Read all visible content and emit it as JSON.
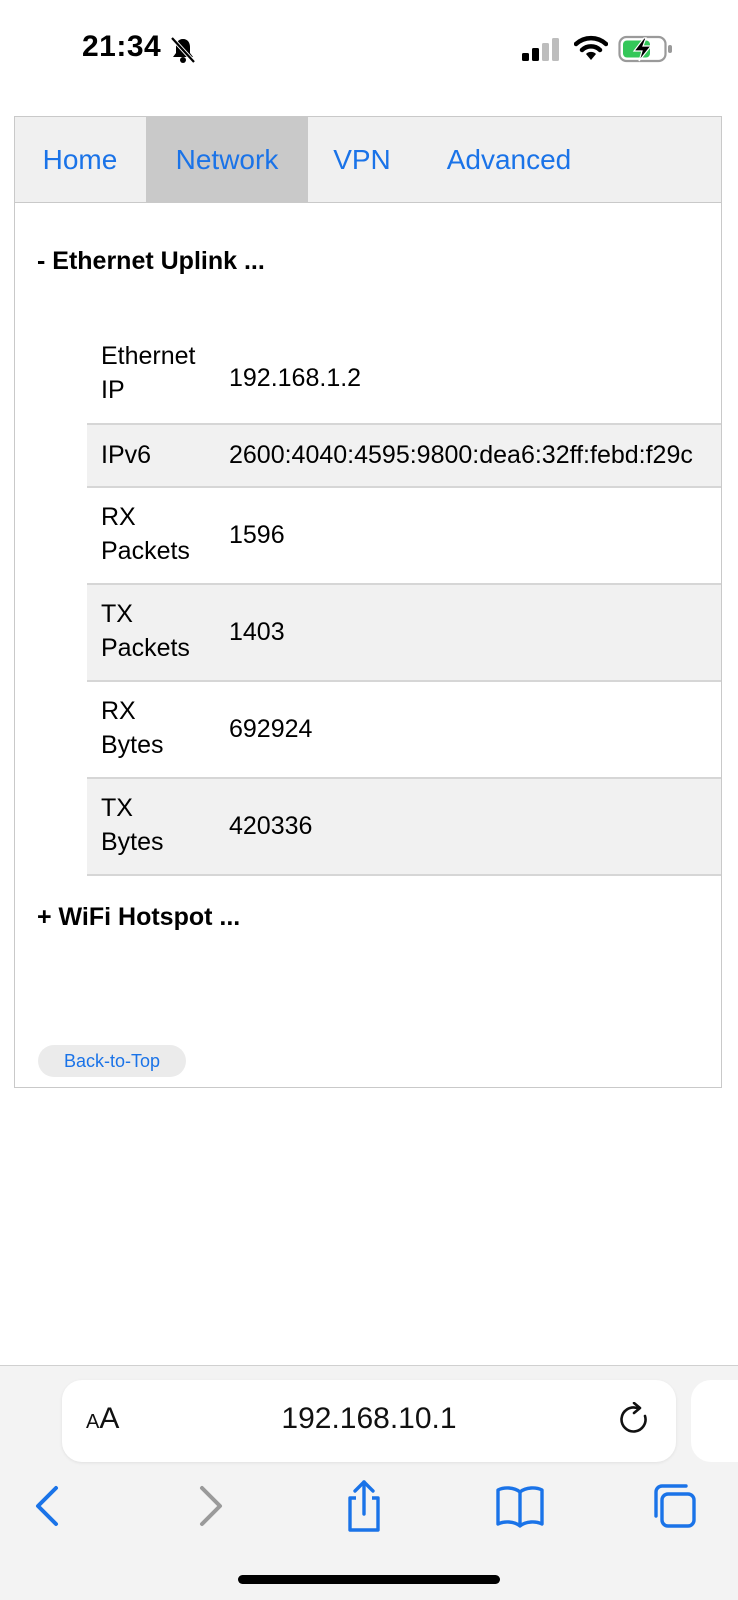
{
  "status_bar": {
    "time": "21:34",
    "colors": {
      "battery_fill": "#34c759"
    }
  },
  "tabs": [
    {
      "label": "Home",
      "active": false
    },
    {
      "label": "Network",
      "active": true
    },
    {
      "label": "VPN",
      "active": false
    },
    {
      "label": "Advanced",
      "active": false
    }
  ],
  "ethernet": {
    "heading": "- Ethernet Uplink ...",
    "rows": [
      {
        "key_line1": "Ethernet",
        "key_line2": "IP",
        "value": "192.168.1.2"
      },
      {
        "key_line1": "IPv6",
        "key_line2": "",
        "value": "2600:4040:4595:9800:dea6:32ff:febd:f29c"
      },
      {
        "key_line1": "RX",
        "key_line2": "Packets",
        "value": "1596"
      },
      {
        "key_line1": "TX",
        "key_line2": "Packets",
        "value": "1403"
      },
      {
        "key_line1": "RX",
        "key_line2": "Bytes",
        "value": "692924"
      },
      {
        "key_line1": "TX",
        "key_line2": "Bytes",
        "value": "420336"
      }
    ]
  },
  "wifi": {
    "heading": "+ WiFi Hotspot ..."
  },
  "back_to_top": "Back-to-Top",
  "browser": {
    "text_size_small": "A",
    "text_size_large": "A",
    "url": "192.168.10.1",
    "icons": [
      "back-icon",
      "forward-icon",
      "share-icon",
      "bookmarks-icon",
      "tabs-icon",
      "reload-icon"
    ]
  },
  "colors": {
    "link": "#1a73e8",
    "tab_active_bg": "#c9c9c9",
    "row_alt_bg": "#f1f1f1"
  }
}
